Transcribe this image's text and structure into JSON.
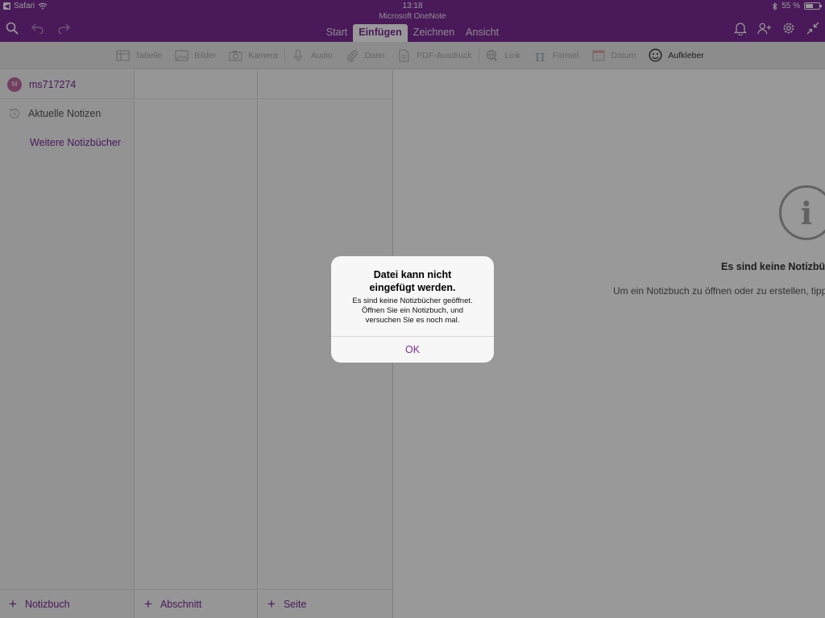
{
  "status_bar": {
    "back_app": "Safari",
    "time": "13:18",
    "battery": "55 %",
    "battery_level": 0.55
  },
  "app": {
    "title": "Microsoft OneNote"
  },
  "tabs": [
    {
      "label": "Start",
      "active": false
    },
    {
      "label": "Einfügen",
      "active": true
    },
    {
      "label": "Zeichnen",
      "active": false
    },
    {
      "label": "Ansicht",
      "active": false
    }
  ],
  "ribbon": {
    "table": "Tabelle",
    "pictures": "Bilder",
    "camera": "Kamera",
    "audio": "Audio",
    "file": "Datei",
    "pdf": "PDF-Ausdruck",
    "link": "Link",
    "formula": "Formel",
    "date": "Datum",
    "sticker": "Aufkleber"
  },
  "sidebar": {
    "account": "ms717274",
    "avatar_letter": "M",
    "recent": "Aktuelle Notizen",
    "more": "Weitere Notizbücher"
  },
  "bottom": {
    "notebook": "Notizbuch",
    "section": "Abschnitt",
    "page": "Seite"
  },
  "empty_state": {
    "title": "Es sind keine Notizbüc",
    "subtitle": "Um ein Notizbuch zu öffnen oder zu erstellen, tippe"
  },
  "alert": {
    "title_line1": "Datei kann nicht",
    "title_line2": "eingefügt werden.",
    "msg_line1": "Es sind keine Notizbücher geöffnet.",
    "msg_line2": "Öffnen Sie ein Notizbuch, und",
    "msg_line3": "versuchen Sie es noch mal.",
    "button": "OK"
  },
  "colors": {
    "accent": "#7a2a95",
    "ribbon": "#eaeaea"
  }
}
